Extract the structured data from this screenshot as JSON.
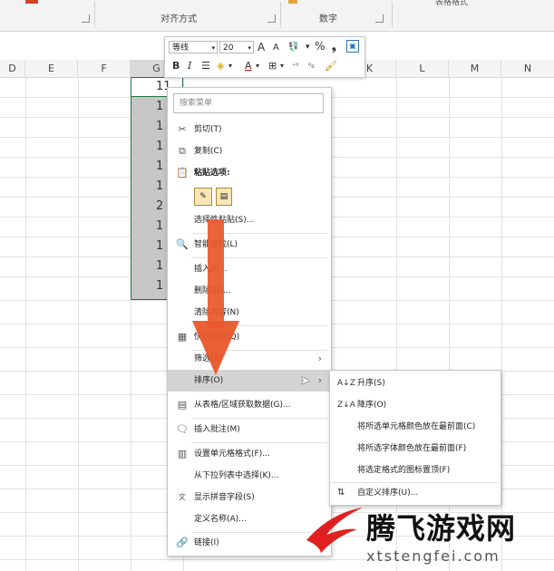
{
  "ribbon": {
    "groups": [
      "对齐方式",
      "数字"
    ],
    "right_label": "表格格式"
  },
  "columns": [
    "D",
    "E",
    "F",
    "G",
    "K",
    "L",
    "M",
    "N"
  ],
  "cells": [
    "11",
    "1",
    "1",
    "1",
    "1",
    "1",
    "2",
    "1",
    "1",
    "1",
    "1"
  ],
  "mini_toolbar": {
    "font_name": "等线",
    "font_size": "20",
    "grow_font": "A",
    "shrink_font": "A",
    "percent": "%",
    "comma": "❟",
    "bold": "B",
    "italic": "I",
    "font_color_letter": "A"
  },
  "context_menu": {
    "search_placeholder": "搜索菜单",
    "items": [
      {
        "label": "剪切(T)",
        "icon": "scissors-icon",
        "glyph": "✂"
      },
      {
        "label": "复制(C)",
        "icon": "copy-icon",
        "glyph": "⧉"
      },
      {
        "label": "粘贴选项:",
        "icon": "paste-icon",
        "glyph": "📋"
      },
      {
        "label": "选择性粘贴(S)...",
        "icon": "",
        "glyph": ""
      },
      {
        "label": "智能查找(L)",
        "icon": "smart-lookup-icon",
        "glyph": "🔍"
      },
      {
        "label": "插入(I)...",
        "icon": "",
        "glyph": ""
      },
      {
        "label": "删除(D)...",
        "icon": "",
        "glyph": ""
      },
      {
        "label": "清除内容(N)",
        "icon": "",
        "glyph": ""
      },
      {
        "label": "快速分析(Q)",
        "icon": "quick-analysis-icon",
        "glyph": "▦"
      },
      {
        "label": "筛选(E)",
        "icon": "",
        "glyph": ""
      },
      {
        "label": "排序(O)",
        "icon": "",
        "glyph": ""
      },
      {
        "label": "从表格/区域获取数据(G)...",
        "icon": "table-icon",
        "glyph": "▤"
      },
      {
        "label": "插入批注(M)",
        "icon": "comment-icon",
        "glyph": "🗨"
      },
      {
        "label": "设置单元格格式(F)...",
        "icon": "format-cells-icon",
        "glyph": "▥"
      },
      {
        "label": "从下拉列表中选择(K)...",
        "icon": "",
        "glyph": ""
      },
      {
        "label": "显示拼音字段(S)",
        "icon": "phonetic-icon",
        "glyph": "文"
      },
      {
        "label": "定义名称(A)...",
        "icon": "",
        "glyph": ""
      },
      {
        "label": "链接(I)",
        "icon": "link-icon",
        "glyph": "🔗"
      }
    ],
    "submenu_arrow": "›"
  },
  "sort_submenu": {
    "items": [
      {
        "label": "升序(S)",
        "icon": "sort-ascending-icon",
        "glyph": "A↓Z"
      },
      {
        "label": "降序(O)",
        "icon": "sort-descending-icon",
        "glyph": "Z↓A"
      },
      {
        "label": "将所选单元格颜色放在最前面(C)",
        "icon": "",
        "glyph": ""
      },
      {
        "label": "将所选字体颜色放在最前面(F)",
        "icon": "",
        "glyph": ""
      },
      {
        "label": "将选定格式的图标置顶(F)",
        "icon": "",
        "glyph": ""
      },
      {
        "label": "自定义排序(U)...",
        "icon": "custom-sort-icon",
        "glyph": "⇅"
      }
    ]
  },
  "watermark": {
    "title": "腾飞游戏网",
    "url": "xtstengfei.com"
  },
  "colors": {
    "accent_arrow": "#e8572a",
    "selection_border": "#217346",
    "highlight": "#d4d4d4"
  }
}
